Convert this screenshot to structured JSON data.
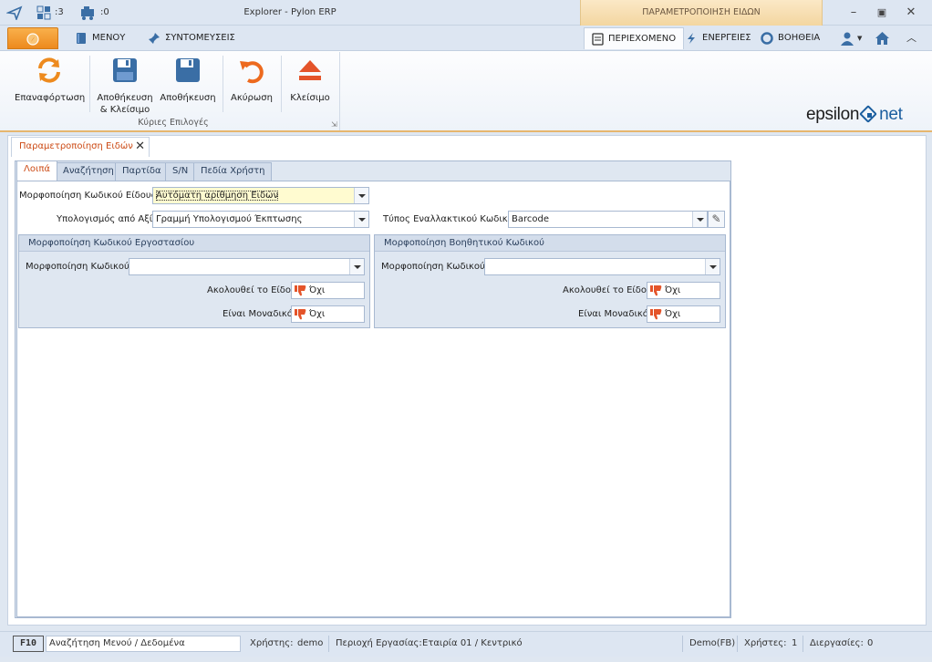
{
  "titlebar": {
    "title": "Explorer - Pylon ERP",
    "context_tab": "ΠΑΡΑΜΕΤΡΟΠΟΙΗΣΗ ΕΙΔΩΝ",
    "windows_count": ":3",
    "tasks_count": ":0"
  },
  "menu_tabs": {
    "menu": "ΜΕΝΟΥ",
    "shortcuts": "ΣΥΝΤΟΜΕΥΣΕΙΣ",
    "content": "ΠΕΡΙΕΧΟΜΕΝΟ",
    "actions": "ΕΝΕΡΓΕΙΕΣ",
    "help": "ΒΟΗΘΕΙΑ"
  },
  "ribbon": {
    "refresh": "Επαναφόρτωση",
    "save_close_line1": "Αποθήκευση",
    "save_close_line2": "& Κλείσιμο",
    "save": "Αποθήκευση",
    "cancel": "Ακύρωση",
    "close": "Κλείσιμο",
    "group_label": "Κύριες Επιλογές"
  },
  "logo": {
    "text_a": "epsilon",
    "text_b": "net"
  },
  "doc_tab": {
    "title": "Παραμετροποίηση Ειδών",
    "close": "✕"
  },
  "form_tabs": [
    "Λοιπά",
    "Αναζήτηση",
    "Παρτίδα",
    "S/N",
    "Πεδία Χρήστη"
  ],
  "fields": {
    "code_format_label": "Μορφοποίηση Κωδικού Είδους",
    "code_format_value": "Αυτόματη αρίθμηση Ειδών",
    "calc_from_value_label": "Υπολογισμός από Αξία",
    "calc_from_value_value": "Γραμμή Υπολογισμού Έκπτωσης",
    "alt_code_type_label": "Τύπος Εναλλακτικού Κωδικού",
    "alt_code_type_value": "Barcode"
  },
  "groups": {
    "factory": {
      "title": "Μορφοποίηση  Κωδικού Εργοστασίου",
      "code_format_label": "Μορφοποίηση Κωδικού",
      "code_format_value": "",
      "follows_item_label": "Ακολουθεί το Είδος",
      "follows_item_value": "Όχι",
      "unique_label": "Είναι Μοναδικό",
      "unique_value": "Όχι"
    },
    "auxiliary": {
      "title": "Μορφοποίηση Βοηθητικού Κωδικού",
      "code_format_label": "Μορφοποίηση Κωδικού",
      "code_format_value": "",
      "follows_item_label": "Ακολουθεί το Είδος",
      "follows_item_value": "Όχι",
      "unique_label": "Είναι Μοναδικό",
      "unique_value": "Όχι"
    }
  },
  "statusbar": {
    "f10": "F10",
    "search_placeholder": "Αναζήτηση Μενού / Δεδομένα",
    "user_label": "Χρήστης:",
    "user_value": "demo",
    "area_label": "Περιοχή Εργασίας:",
    "area_value": "Εταιρία 01 / Κεντρικό",
    "db": "Demo(FB)",
    "users_label": "Χρήστες:",
    "users_value": "1",
    "processes_label": "Διεργασίες:",
    "processes_value": "0"
  },
  "colors": {
    "accent": "#cc4a14",
    "brand_blue": "#1b5e9f",
    "orange": "#ed8a1e"
  }
}
